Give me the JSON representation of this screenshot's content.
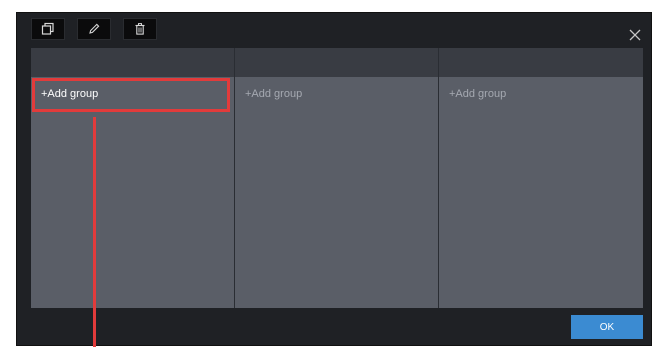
{
  "toolbar": {
    "buttons": [
      {
        "icon": "duplicate-icon"
      },
      {
        "icon": "pencil-icon"
      },
      {
        "icon": "trash-icon"
      }
    ]
  },
  "close": {
    "icon": "close-icon"
  },
  "columns": [
    {
      "add_label": "+Add group",
      "highlighted": true
    },
    {
      "add_label": "+Add group",
      "highlighted": false
    },
    {
      "add_label": "+Add group",
      "highlighted": false
    }
  ],
  "footer": {
    "ok_label": "OK"
  },
  "colors": {
    "dialog_bg": "#1f2125",
    "column_header": "#393c43",
    "column_body": "#5a5e67",
    "accent_blue": "#3b8bd2",
    "highlight_red": "#e23b3b"
  }
}
